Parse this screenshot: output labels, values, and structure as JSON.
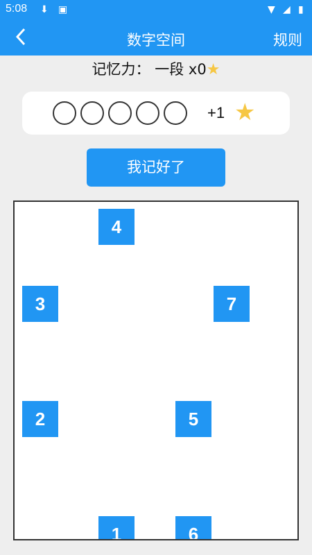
{
  "status": {
    "time": "5:08"
  },
  "appbar": {
    "title": "数字空间",
    "rules_label": "规则",
    "back_icon": "chevron-left-icon"
  },
  "memory": {
    "label": "记忆力：",
    "level": "一段",
    "multiplier": "x0",
    "star_icon": "star-icon"
  },
  "progress": {
    "slots": 5,
    "bonus": "+1"
  },
  "button": {
    "label": "我记好了"
  },
  "board": {
    "tiles": [
      {
        "value": "4"
      },
      {
        "value": "3"
      },
      {
        "value": "7"
      },
      {
        "value": "2"
      },
      {
        "value": "5"
      },
      {
        "value": "1"
      },
      {
        "value": "6"
      }
    ]
  },
  "colors": {
    "primary": "#2196F3",
    "star": "#F6C744",
    "background": "#EEEEEE"
  }
}
